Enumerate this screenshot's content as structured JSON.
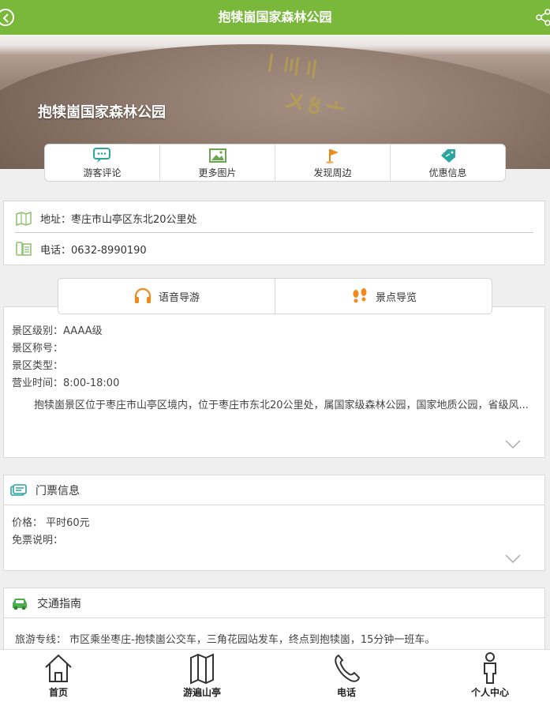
{
  "header": {
    "title": "抱犊崮国家森林公园"
  },
  "hero": {
    "title": "抱犊崮国家森林公园"
  },
  "quick_menu": [
    {
      "label": "游客评论",
      "icon": "comment-icon"
    },
    {
      "label": "更多图片",
      "icon": "picture-icon"
    },
    {
      "label": "发现周边",
      "icon": "flag-icon"
    },
    {
      "label": "优惠信息",
      "icon": "coupon-icon"
    }
  ],
  "info": {
    "address": "地址：枣庄市山亭区东北20公里处",
    "phone": "电话：0632-8990190"
  },
  "guide_tabs": [
    {
      "label": "语音导游",
      "icon": "headphones-icon"
    },
    {
      "label": "景点导览",
      "icon": "footprints-icon"
    }
  ],
  "description": {
    "level": "景区级别：AAAA级",
    "honor": "景区称号：",
    "type": "景区类型：",
    "hours": "营业时间：8:00-18:00",
    "intro": "抱犊崮景区位于枣庄市山亭区境内，位于枣庄市东北20公里处，属国家级森林公园，国家地质公园，省级风..."
  },
  "ticket": {
    "title": "门票信息",
    "price": "价格：  平时60元",
    "free": "免票说明："
  },
  "traffic": {
    "title": "交通指南",
    "route": "旅游专线：  市区乘坐枣庄-抱犊崮公交车，三角花园站发车，终点到抱犊崮，15分钟一班车。"
  },
  "bottom_nav": [
    {
      "label": "首页",
      "icon": "home-icon"
    },
    {
      "label": "游遍山亭",
      "icon": "map-icon"
    },
    {
      "label": "电话",
      "icon": "phone-icon"
    },
    {
      "label": "个人中心",
      "icon": "person-icon"
    }
  ],
  "colors": {
    "brand": "#7ab83c",
    "accent_orange": "#f08a1c",
    "teal": "#2aa5a0"
  }
}
